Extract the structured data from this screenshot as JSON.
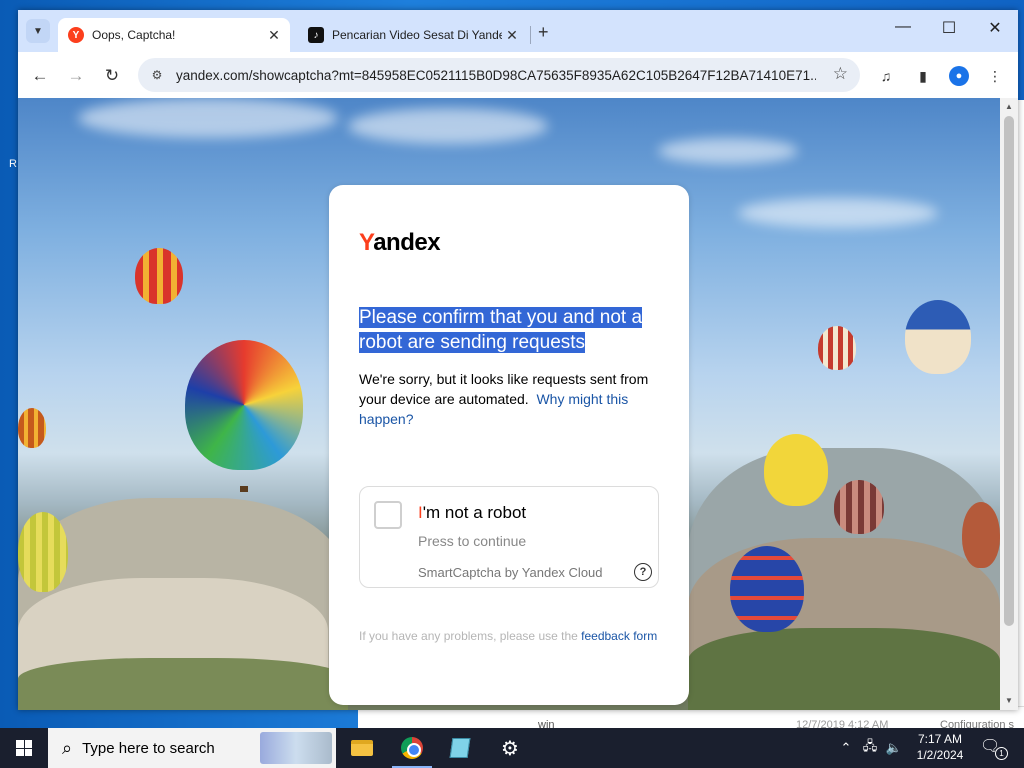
{
  "browser": {
    "tabs": [
      {
        "title": "Oops, Captcha!",
        "favicon": "yandex-favicon",
        "active": true
      },
      {
        "title": "Pencarian Video Sesat Di Yande",
        "favicon": "tiktok-favicon",
        "active": false
      }
    ],
    "new_tab_label": "+",
    "url": "yandex.com/showcaptcha?mt=845958EC0521115B0D98CA75635F8935A62C105B2647F12BA71410E71...",
    "accent": "#d3e3fd"
  },
  "captcha": {
    "logo": {
      "first_letter": "Y",
      "rest": "andex"
    },
    "heading": "Please confirm that you and not a robot are sending requests",
    "description": "We're sorry, but it looks like requests sent from your device are automated.",
    "why_link": "Why might this happen?",
    "checkbox_title_first": "I",
    "checkbox_title_rest": "'m not a robot",
    "checkbox_subtitle": "Press to continue",
    "brand": "SmartCaptcha by Yandex Cloud",
    "help_icon": "?",
    "feedback_text": "If you have any problems, please use the",
    "feedback_link": "feedback form",
    "brand_color": "#fc3f1d",
    "selection_color": "#3367d6"
  },
  "background_window": {
    "file_name": "win",
    "date": "12/7/2019 4:12 AM",
    "type": "Configuration s"
  },
  "desktop": {
    "edge_letter": "R"
  },
  "taskbar": {
    "search_placeholder": "Type here to search",
    "time": "7:17 AM",
    "date": "1/2/2024",
    "notification_count": "1",
    "apps": [
      "file-explorer",
      "chrome",
      "notepad",
      "settings"
    ]
  }
}
